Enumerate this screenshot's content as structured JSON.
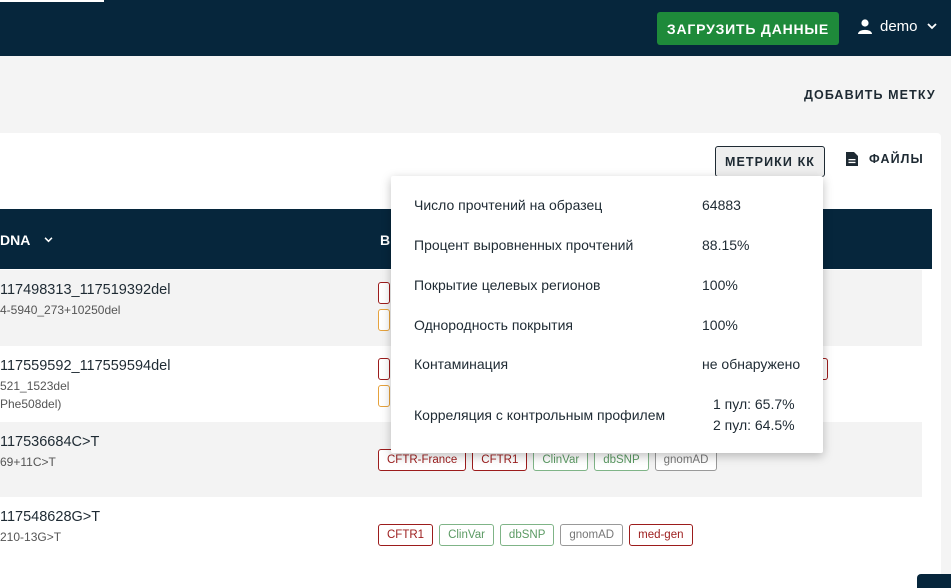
{
  "header": {
    "upload_button": "ЗАГРУЗИТЬ ДАННЫЕ",
    "username": "demo"
  },
  "toolbar": {
    "add_label": "ДОБАВИТЬ МЕТКУ",
    "metrics_button": "МЕТРИКИ КК",
    "files_button": "ФАЙЛЫ"
  },
  "table": {
    "columns": [
      "DNA",
      "В"
    ],
    "rows": [
      {
        "main": "117498313_117519392del",
        "sub": [
          "4-5940_273+10250del"
        ]
      },
      {
        "main": "117559592_117559594del",
        "sub": [
          "521_1523del",
          "Phe508del)"
        ]
      },
      {
        "main": "117536684C>T",
        "sub": [
          "69+11C>T"
        ],
        "tags": [
          "CFTR-France",
          "CFTR1",
          "ClinVar",
          "dbSNP",
          "gnomAD"
        ]
      },
      {
        "main": "117548628G>T",
        "sub": [
          "210-13G>T"
        ],
        "tags": [
          "CFTR1",
          "ClinVar",
          "dbSNP",
          "gnomAD",
          "med-gen"
        ]
      }
    ]
  },
  "qc_metrics": {
    "reads_label": "Число прочтений на образец",
    "reads_value": "64883",
    "aligned_label": "Процент выровненных прочтений",
    "aligned_value": "88.15%",
    "coverage_label": "Покрытие целевых регионов",
    "coverage_value": "100%",
    "uniformity_label": "Однородность покрытия",
    "uniformity_value": "100%",
    "contamination_label": "Контаминация",
    "contamination_value": "не обнаружено",
    "correlation_label": "Корреляция с контрольным профилем",
    "correlation_values": [
      "1 пул: 65.7%",
      "2 пул: 64.5%"
    ]
  },
  "colors": {
    "header_bg": "#06263c",
    "upload_green": "#1e8a3a",
    "tag_red": "#9c1c1c",
    "tag_green": "#7fb487",
    "tag_orange": "#e6a23c"
  },
  "icons": [
    "user-icon",
    "chevron-down-icon",
    "file-icon"
  ]
}
